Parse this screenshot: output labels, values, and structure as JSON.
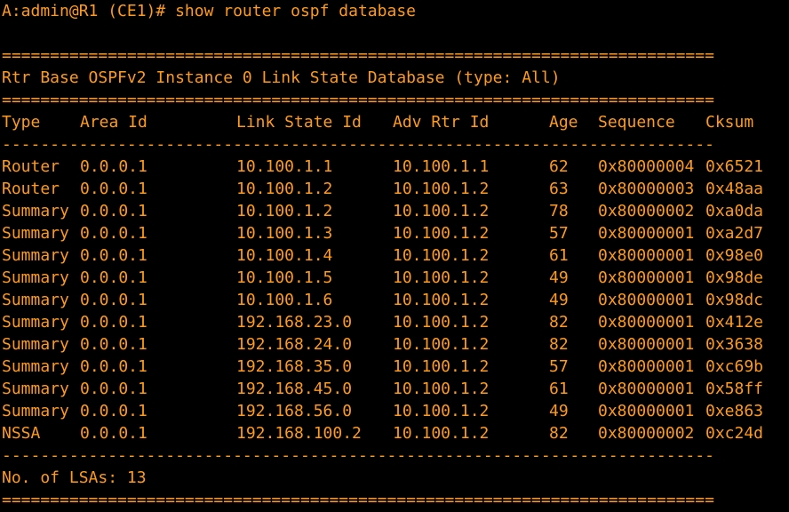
{
  "terminal": {
    "prompt_line": "A:admin@R1 (CE1)# show router ospf database",
    "double_rule": "==========================================================================",
    "single_rule": "--------------------------------------------------------------------------",
    "title": "Rtr Base OSPFv2 Instance 0 Link State Database (type: All)",
    "headers": {
      "type": "Type",
      "area_id": "Area Id",
      "link_state_id": "Link State Id",
      "adv_rtr_id": "Adv Rtr Id",
      "age": "Age",
      "sequence": "Sequence",
      "cksum": "Cksum"
    },
    "rows": [
      {
        "type": "Router",
        "area_id": "0.0.0.1",
        "link_state_id": "10.100.1.1",
        "adv_rtr_id": "10.100.1.1",
        "age": "62",
        "sequence": "0x80000004",
        "cksum": "0x6521"
      },
      {
        "type": "Router",
        "area_id": "0.0.0.1",
        "link_state_id": "10.100.1.2",
        "adv_rtr_id": "10.100.1.2",
        "age": "63",
        "sequence": "0x80000003",
        "cksum": "0x48aa"
      },
      {
        "type": "Summary",
        "area_id": "0.0.0.1",
        "link_state_id": "10.100.1.2",
        "adv_rtr_id": "10.100.1.2",
        "age": "78",
        "sequence": "0x80000002",
        "cksum": "0xa0da"
      },
      {
        "type": "Summary",
        "area_id": "0.0.0.1",
        "link_state_id": "10.100.1.3",
        "adv_rtr_id": "10.100.1.2",
        "age": "57",
        "sequence": "0x80000001",
        "cksum": "0xa2d7"
      },
      {
        "type": "Summary",
        "area_id": "0.0.0.1",
        "link_state_id": "10.100.1.4",
        "adv_rtr_id": "10.100.1.2",
        "age": "61",
        "sequence": "0x80000001",
        "cksum": "0x98e0"
      },
      {
        "type": "Summary",
        "area_id": "0.0.0.1",
        "link_state_id": "10.100.1.5",
        "adv_rtr_id": "10.100.1.2",
        "age": "49",
        "sequence": "0x80000001",
        "cksum": "0x98de"
      },
      {
        "type": "Summary",
        "area_id": "0.0.0.1",
        "link_state_id": "10.100.1.6",
        "adv_rtr_id": "10.100.1.2",
        "age": "49",
        "sequence": "0x80000001",
        "cksum": "0x98dc"
      },
      {
        "type": "Summary",
        "area_id": "0.0.0.1",
        "link_state_id": "192.168.23.0",
        "adv_rtr_id": "10.100.1.2",
        "age": "82",
        "sequence": "0x80000001",
        "cksum": "0x412e"
      },
      {
        "type": "Summary",
        "area_id": "0.0.0.1",
        "link_state_id": "192.168.24.0",
        "adv_rtr_id": "10.100.1.2",
        "age": "82",
        "sequence": "0x80000001",
        "cksum": "0x3638"
      },
      {
        "type": "Summary",
        "area_id": "0.0.0.1",
        "link_state_id": "192.168.35.0",
        "adv_rtr_id": "10.100.1.2",
        "age": "57",
        "sequence": "0x80000001",
        "cksum": "0xc69b"
      },
      {
        "type": "Summary",
        "area_id": "0.0.0.1",
        "link_state_id": "192.168.45.0",
        "adv_rtr_id": "10.100.1.2",
        "age": "61",
        "sequence": "0x80000001",
        "cksum": "0x58ff"
      },
      {
        "type": "Summary",
        "area_id": "0.0.0.1",
        "link_state_id": "192.168.56.0",
        "adv_rtr_id": "10.100.1.2",
        "age": "49",
        "sequence": "0x80000001",
        "cksum": "0xe863"
      },
      {
        "type": "NSSA",
        "area_id": "0.0.0.1",
        "link_state_id": "192.168.100.2",
        "adv_rtr_id": "10.100.1.2",
        "age": "82",
        "sequence": "0x80000002",
        "cksum": "0xc24d"
      }
    ],
    "footer": "No. of LSAs: 13",
    "colors": {
      "background": "#000000",
      "text": "#ff9a1a"
    }
  }
}
